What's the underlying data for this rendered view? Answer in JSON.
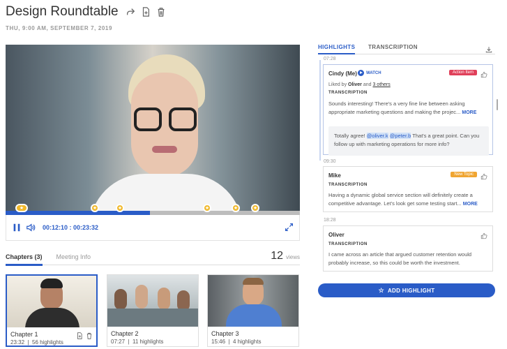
{
  "header": {
    "title": "Design Roundtable",
    "date": "THU, 9:00 AM, SEPTEMBER 7, 2019"
  },
  "player": {
    "current_time": "00:12:10",
    "separator": " : ",
    "duration": "00:23:32",
    "progress_fraction": 0.49,
    "marker_count": 6
  },
  "left_tabs": {
    "chapters_label": "Chapters (3)",
    "meeting_info_label": "Meeting Info",
    "views_count": "12",
    "views_label": "views"
  },
  "chapters": [
    {
      "name": "Chapter 1",
      "duration": "23:32",
      "highlights": "56 highlights",
      "selected": true
    },
    {
      "name": "Chapter 2",
      "duration": "07:27",
      "highlights": "11 highlights",
      "selected": false
    },
    {
      "name": "Chapter 3",
      "duration": "15:46",
      "highlights": "4 highlights",
      "selected": false
    }
  ],
  "right_tabs": {
    "highlights_label": "HIGHLIGHTS",
    "transcription_label": "TRANSCRIPTION"
  },
  "highlights": [
    {
      "timestamp": "07:28",
      "author": "Cindy (Me)",
      "watch_label": "WATCH",
      "tag": "Action Item",
      "tag_color": "#e0405a",
      "liked_prefix": "Liked by ",
      "liked_name": "Oliver",
      "liked_mid": " and ",
      "liked_others": "3 others",
      "section_label": "TRANSCRIPTION",
      "text": "Sounds interesting! There's a very fine line between asking appropriate marketing questions and making the projec...",
      "more_label": "MORE",
      "reply_prefix": "Totally agree! ",
      "reply_mention_1": "@oliver.k",
      "reply_mention_2": "@peter.b",
      "reply_suffix": " That's a great point. Can you follow up with marketing operations for more info?"
    },
    {
      "timestamp": "09:30",
      "author": "Mike",
      "tag": "New Topic",
      "tag_color": "#f0a531",
      "section_label": "TRANSCRIPTION",
      "text": "Having a dynamic global service section will definitely create a competitive advantage. Let's look get some testing start...",
      "more_label": "MORE"
    },
    {
      "timestamp": "18:28",
      "author": "Oliver",
      "section_label": "TRANSCRIPTION",
      "text": "I came across an article that argued customer retention would probably increase, so this could be worth the investment."
    }
  ],
  "add_highlight_label": "ADD HIGHLIGHT",
  "colors": {
    "accent": "#2a5cc7",
    "action_item": "#e0405a",
    "new_topic": "#f0a531",
    "marker": "#f0b82a"
  }
}
